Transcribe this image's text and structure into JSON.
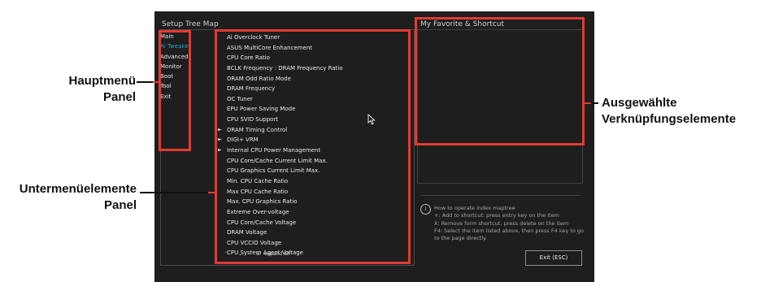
{
  "panels": {
    "left_title": "Setup Tree Map",
    "right_title": "My Favorite & Shortcut"
  },
  "main_menu": [
    {
      "label": "Main",
      "active": false
    },
    {
      "label": "Ai Tweaker",
      "active": true
    },
    {
      "label": "Advanced",
      "active": false
    },
    {
      "label": "Monitor",
      "active": false
    },
    {
      "label": "Boot",
      "active": false
    },
    {
      "label": "Tool",
      "active": false
    },
    {
      "label": "Exit",
      "active": false
    }
  ],
  "submenu": [
    {
      "label": "Ai Overclock Tuner",
      "has_children": false
    },
    {
      "label": "ASUS MultiCore Enhancement",
      "has_children": false
    },
    {
      "label": "CPU Core Ratio",
      "has_children": false
    },
    {
      "label": "BCLK Frequency : DRAM Frequency Ratio",
      "has_children": false
    },
    {
      "label": "DRAM Odd Ratio Mode",
      "has_children": false
    },
    {
      "label": "DRAM Frequency",
      "has_children": false
    },
    {
      "label": "OC Tuner",
      "has_children": false
    },
    {
      "label": "EPU Power Saving Mode",
      "has_children": false
    },
    {
      "label": "CPU SVID Support",
      "has_children": false
    },
    {
      "label": "DRAM Timing Control",
      "has_children": true
    },
    {
      "label": "DIGI+ VRM",
      "has_children": true
    },
    {
      "label": "Internal CPU Power Management",
      "has_children": true
    },
    {
      "label": "CPU Core/Cache Current Limit Max.",
      "has_children": false
    },
    {
      "label": "CPU Graphics Current Limit Max.",
      "has_children": false
    },
    {
      "label": "Min. CPU Cache Ratio",
      "has_children": false
    },
    {
      "label": "Max CPU Cache Ratio",
      "has_children": false
    },
    {
      "label": "Max. CPU Graphics Ratio",
      "has_children": false
    },
    {
      "label": "Extreme Over-voltage",
      "has_children": false
    },
    {
      "label": "CPU Core/Cache Voltage",
      "has_children": false
    },
    {
      "label": "DRAM Voltage",
      "has_children": false
    },
    {
      "label": "CPU VCCIO Voltage",
      "has_children": false
    },
    {
      "label": "CPU System Agent Voltage",
      "has_children": false
    }
  ],
  "bottom_bar": {
    "collapse_icon": "double-chevron-up-icon",
    "expand_icon": "double-chevron-down-icon",
    "expand_all_icon": "list-icon",
    "expand_all_label": "expand all"
  },
  "info": {
    "icon": "info-icon",
    "lines": [
      "How to operate index maptree",
      "+: Add to shortcut: press entry key on the item",
      "X: Remove form shortcut: press delete on the item",
      "F4: Select the item listed above, then press F4 key to go to the page directly."
    ]
  },
  "exit_button": "Exit (ESC)",
  "callouts": {
    "main_menu_line1": "Hauptmenü",
    "main_menu_line2": "Panel",
    "submenu_line1": "Untermenüelemente",
    "submenu_line2": "Panel",
    "favorites_line1": "Ausgewählte",
    "favorites_line2": "Verknüpfungselemente"
  },
  "colors": {
    "screen_bg": "#1e1e1e",
    "active_menu": "#27a0c9",
    "highlight_frame": "#e23a33"
  }
}
